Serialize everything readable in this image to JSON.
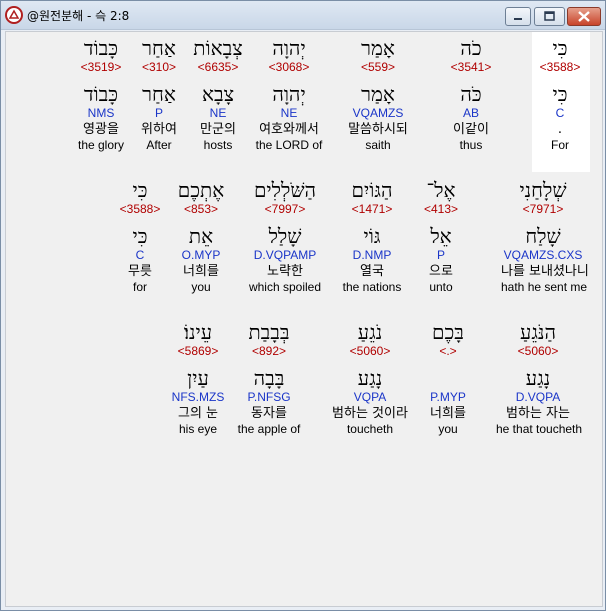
{
  "window": {
    "title": "@원전분해 - 슥 2:8"
  },
  "rows": [
    {
      "words": [
        {
          "heb": "כִּי",
          "strong": "<3588>",
          "lemma": "כִּי",
          "morph": "C",
          "kor": ".",
          "eng": "For"
        },
        {
          "heb": "כֹה",
          "strong": "<3541>",
          "lemma": "כֹּה",
          "morph": "AB",
          "kor": "이같이",
          "eng": "thus"
        },
        {
          "heb": "אָמַר",
          "strong": "<559>",
          "lemma": "אָמַר",
          "morph": "VQAMZS",
          "kor": "말씀하시되",
          "eng": "saith"
        },
        {
          "heb": "יְהוָה",
          "strong": "<3068>",
          "lemma": "יְהוָה",
          "morph": "NE",
          "kor": "여호와께서",
          "eng": "the LORD of"
        },
        {
          "heb": "צְבָאוֹת",
          "strong": "<6635>",
          "lemma": "צָבָא",
          "morph": "NE",
          "kor": "만군의",
          "eng": "hosts"
        },
        {
          "heb": "אַחַר",
          "strong": "<310>",
          "lemma": "אַחַר",
          "morph": "P",
          "kor": "위하여",
          "eng": "After"
        },
        {
          "heb": "כָּבוֹד",
          "strong": "<3519>",
          "lemma": "כָּבוֹד",
          "morph": "NMS",
          "kor": "영광을",
          "eng": "the glory"
        }
      ]
    },
    {
      "words": [
        {
          "heb": "שְׁלָחַנִי",
          "strong": "<7971>",
          "lemma": "שָׁלַח",
          "morph": "VQAMZS.CXS",
          "kor": "나를 보내셨나니",
          "eng": "hath he sent me"
        },
        {
          "heb": "אֶל־",
          "strong": "<413>",
          "lemma": "אֵל",
          "morph": "P",
          "kor": "으로",
          "eng": "unto"
        },
        {
          "heb": "הַגּוֹיִם",
          "strong": "<1471>",
          "lemma": "גּוֹי",
          "morph": "D.NMP",
          "kor": "열국",
          "eng": "the nations"
        },
        {
          "heb": "הַשֹּׁלְלִים",
          "strong": "<7997>",
          "lemma": "שָׁלַל",
          "morph": "D.VQPAMP",
          "kor": "노략한",
          "eng": "which spoiled"
        },
        {
          "heb": "אֶתְכֶם",
          "strong": "<853>",
          "lemma": "אֵת",
          "morph": "O.MYP",
          "kor": "너희를",
          "eng": "you"
        },
        {
          "heb": "כִּי",
          "strong": "<3588>",
          "lemma": "כִּי",
          "morph": "C",
          "kor": "무릇",
          "eng": "for"
        }
      ]
    },
    {
      "words": [
        {
          "heb": "הַנֹּגֵעַ",
          "strong": "<5060>",
          "lemma": "נָגַע",
          "morph": "D.VQPA",
          "kor": "범하는 자는",
          "eng": "he that toucheth"
        },
        {
          "heb": "בָּכֶם",
          "strong": "<.>",
          "lemma": "",
          "morph": "P.MYP",
          "kor": "너희를",
          "eng": "you"
        },
        {
          "heb": "נֹגֵעַ",
          "strong": "<5060>",
          "lemma": "נָגַע",
          "morph": "VQPA",
          "kor": "범하는 것이라",
          "eng": "toucheth"
        },
        {
          "heb": "בְּבָבַת",
          "strong": "<892>",
          "lemma": "בָּבָה",
          "morph": "P.NFSG",
          "kor": "동자를",
          "eng": "the apple of"
        },
        {
          "heb": "עֵינוֹ׃",
          "strong": "<5869>",
          "lemma": "עַיִן",
          "morph": "NFS.MZS",
          "kor": "그의 눈",
          "eng": "his eye"
        }
      ]
    }
  ]
}
